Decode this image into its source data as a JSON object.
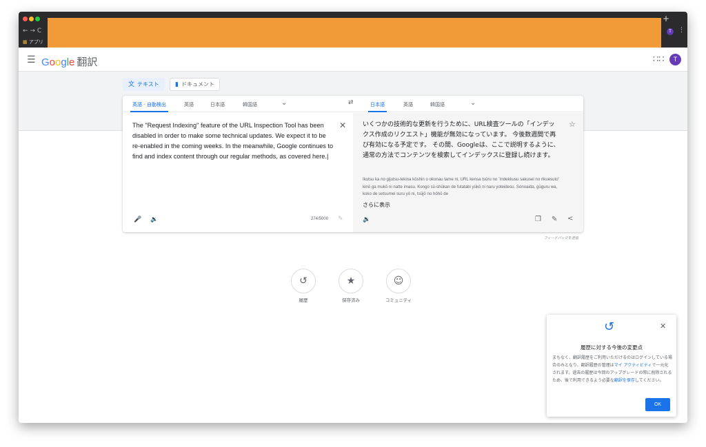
{
  "browser": {
    "bookmarks_label": "アプリ",
    "new_tab": "+",
    "profile_initial": "T"
  },
  "header": {
    "logo": {
      "g": "G",
      "o1": "o",
      "o2": "o",
      "g2": "g",
      "l": "l",
      "e": "e",
      "product": "翻訳"
    },
    "avatar_initial": "T"
  },
  "modes": {
    "text": "テキスト",
    "document": "ドキュメント"
  },
  "source": {
    "languages": [
      "英語 - 自動検出",
      "英語",
      "日本語",
      "韓国語"
    ],
    "text": "The \"Request Indexing\" feature of the URL Inspection Tool has been disabled in order to make some technical updates. We expect it to be re-enabled in the coming weeks. In the meanwhile, Google continues to find and index content through our regular methods, as covered here.",
    "char_count": "274/5000"
  },
  "target": {
    "languages": [
      "日本語",
      "英語",
      "韓国語"
    ],
    "text": "いくつかの技術的な更新を行うために、URL検査ツールの「インデックス作成のリクエスト」機能が無効になっています。 今後数週間で再び有効になる予定です。 その間、Googleは、ここで説明するように、通常の方法でコンテンツを検索してインデックスに登録し続けます。",
    "romaji": "Ikutsu ka no gijutsu-tekina kōshin o okonau tame ni, URL kensa tsūru no `indekkusu sakusei no rikuesuto' kinō ga mukō ni natte imasu. Kongo sū-shūkan de futatabi yūkō ni naru yoteidesu. Sonoaida, gūguru wa, koko de setsumei suru yō ni, tsūjō no hōhō de",
    "more": "さらに表示"
  },
  "feedback": "フィードバックを送信",
  "shortcuts": {
    "history": "履歴",
    "saved": "保存済み",
    "community": "コミュニティ"
  },
  "popup": {
    "title": "履歴に対する今後の変更点",
    "body_1": "まもなく、翻訳履歴をご利用いただけるのはログインしている場合のみとなり、翻訳履歴の管理は",
    "link_1": "マイ アクティビティ",
    "body_2": "で一元化されます。過去の履歴は今回のアップグレードの際に削除されるため、後で利用できるよう必要な",
    "link_2": "翻訳を保存",
    "body_3": "してください。",
    "ok": "OK"
  },
  "colors": {
    "accent": "#1a73e8",
    "redaction": "#f09a38",
    "avatar": "#673ab7"
  }
}
